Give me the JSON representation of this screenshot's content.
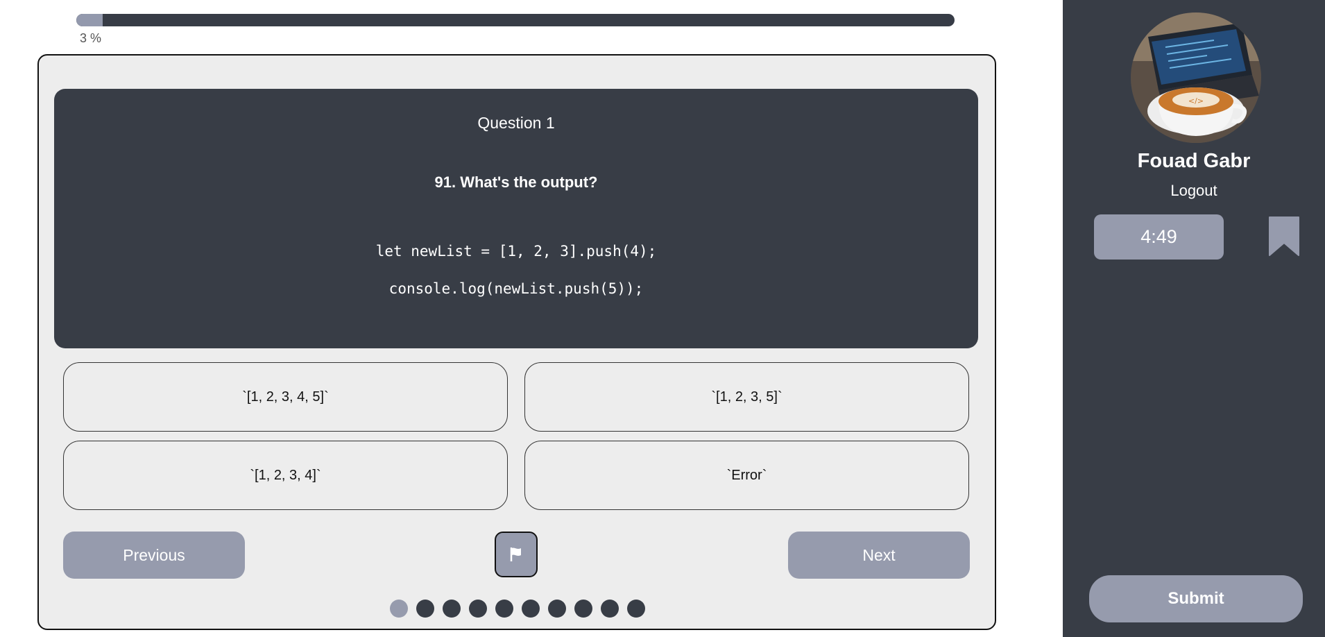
{
  "progress": {
    "percent": 3,
    "label": "3 %"
  },
  "question": {
    "number_label": "Question 1",
    "title": "91. What's the output?",
    "code_lines": [
      "let newList = [1, 2, 3].push(4);",
      "console.log(newList.push(5));"
    ]
  },
  "answers": [
    "`[1, 2, 3, 4, 5]`",
    "`[1, 2, 3, 5]`",
    "`[1, 2, 3, 4]`",
    "`Error`"
  ],
  "navigation": {
    "previous_label": "Previous",
    "next_label": "Next",
    "flag_icon": "flag-icon"
  },
  "question_dots": {
    "count": 10,
    "active_index": 0
  },
  "sidebar": {
    "user_name": "Fouad Gabr",
    "logout_label": "Logout",
    "timer": "4:49",
    "bookmark_icon": "bookmark-icon",
    "submit_label": "Submit"
  },
  "colors": {
    "dark": "#383d46",
    "accent": "#969bad",
    "card_bg": "#ededed"
  }
}
